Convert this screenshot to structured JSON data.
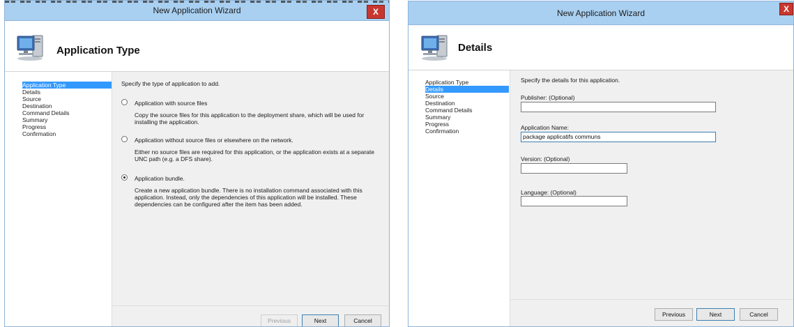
{
  "left": {
    "window_title": "New Application Wizard",
    "close_label": "X",
    "header_title": "Application Type",
    "steps": [
      {
        "label": "Application Type",
        "active": true
      },
      {
        "label": "Details"
      },
      {
        "label": "Source"
      },
      {
        "label": "Destination"
      },
      {
        "label": "Command Details"
      },
      {
        "label": "Summary"
      },
      {
        "label": "Progress"
      },
      {
        "label": "Confirmation"
      }
    ],
    "intro": "Specify the type of application to add.",
    "options": [
      {
        "label": "Application with source files",
        "description": "Copy the source files for this application to the deployment share, which will be used for installing the application.",
        "selected": false
      },
      {
        "label": "Application without source files or elsewhere on the network.",
        "description": "Either no source files are required for this application, or the application exists at a separate UNC path (e.g. a DFS share).",
        "selected": false
      },
      {
        "label": "Application bundle.",
        "description": "Create a new application bundle.  There is no installation command associated with this application.  Instead, only the dependencies of this application will be installed.  These dependencies can be configured after the item has been added.",
        "selected": true
      }
    ],
    "buttons": {
      "previous": "Previous",
      "next": "Next",
      "cancel": "Cancel"
    }
  },
  "right": {
    "window_title": "New Application Wizard",
    "close_label": "X",
    "header_title": "Details",
    "steps": [
      {
        "label": "Application Type"
      },
      {
        "label": "Details",
        "active": true
      },
      {
        "label": "Source"
      },
      {
        "label": "Destination"
      },
      {
        "label": "Command Details"
      },
      {
        "label": "Summary"
      },
      {
        "label": "Progress"
      },
      {
        "label": "Confirmation"
      }
    ],
    "intro": "Specify the details for this application.",
    "fields": {
      "publisher": {
        "label": "Publisher: (Optional)",
        "value": ""
      },
      "app_name": {
        "label": "Application Name:",
        "value": "package applicatifs communs"
      },
      "version": {
        "label": "Version: (Optional)",
        "value": ""
      },
      "language": {
        "label": "Language: (Optional)",
        "value": ""
      }
    },
    "buttons": {
      "previous": "Previous",
      "next": "Next",
      "cancel": "Cancel"
    }
  }
}
